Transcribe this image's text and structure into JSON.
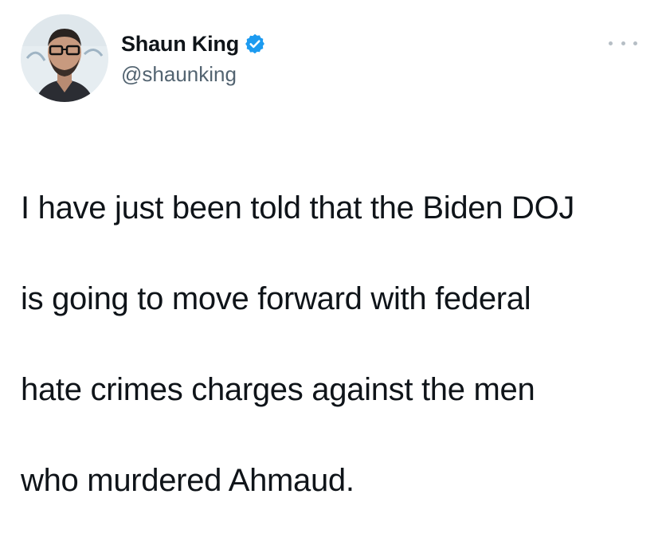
{
  "user": {
    "display_name": "Shaun King",
    "handle": "@shaunking",
    "verified": true,
    "verified_color": "#1d9bf0"
  },
  "more_menu": {
    "icon": "more-horizontal-icon"
  },
  "tweet": {
    "lines": [
      "I have just been told that the Biden DOJ",
      "is going to move forward with federal",
      "hate crimes charges against the men",
      "who murdered Ahmaud."
    ]
  }
}
